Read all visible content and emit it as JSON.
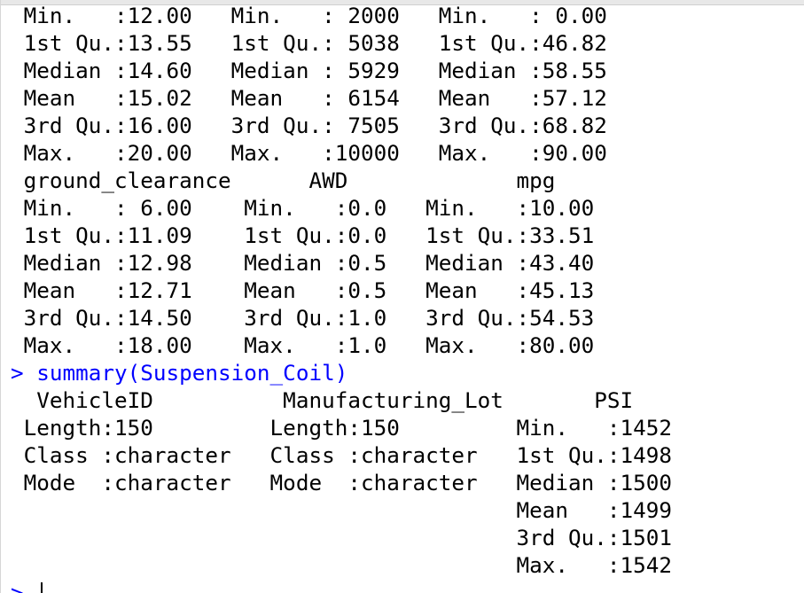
{
  "console": {
    "lines": [
      " Min.   :12.00   Min.   : 2000   Min.   : 0.00  ",
      " 1st Qu.:13.55   1st Qu.: 5038   1st Qu.:46.82  ",
      " Median :14.60   Median : 5929   Median :58.55  ",
      " Mean   :15.02   Mean   : 6154   Mean   :57.12  ",
      " 3rd Qu.:16.00   3rd Qu.: 7505   3rd Qu.:68.82  ",
      " Max.   :20.00   Max.   :10000   Max.   :90.00  ",
      " ground_clearance      AWD             mpg       ",
      " Min.   : 6.00    Min.   :0.0   Min.   :10.00  ",
      " 1st Qu.:11.09    1st Qu.:0.0   1st Qu.:33.51  ",
      " Median :12.98    Median :0.5   Median :43.40  ",
      " Mean   :12.71    Mean   :0.5   Mean   :45.13  ",
      " 3rd Qu.:14.50    3rd Qu.:1.0   3rd Qu.:54.53  ",
      " Max.   :18.00    Max.   :1.0   Max.   :80.00  ",
      "> summary(Suspension_Coil)",
      "  VehicleID          Manufacturing_Lot       PSI      ",
      " Length:150         Length:150         Min.   :1452  ",
      " Class :character   Class :character   1st Qu.:1498  ",
      " Mode  :character   Mode  :character   Median :1500  ",
      "                                       Mean   :1499  ",
      "                                       3rd Qu.:1501  ",
      "                                       Max.   :1542  ",
      "> "
    ]
  }
}
